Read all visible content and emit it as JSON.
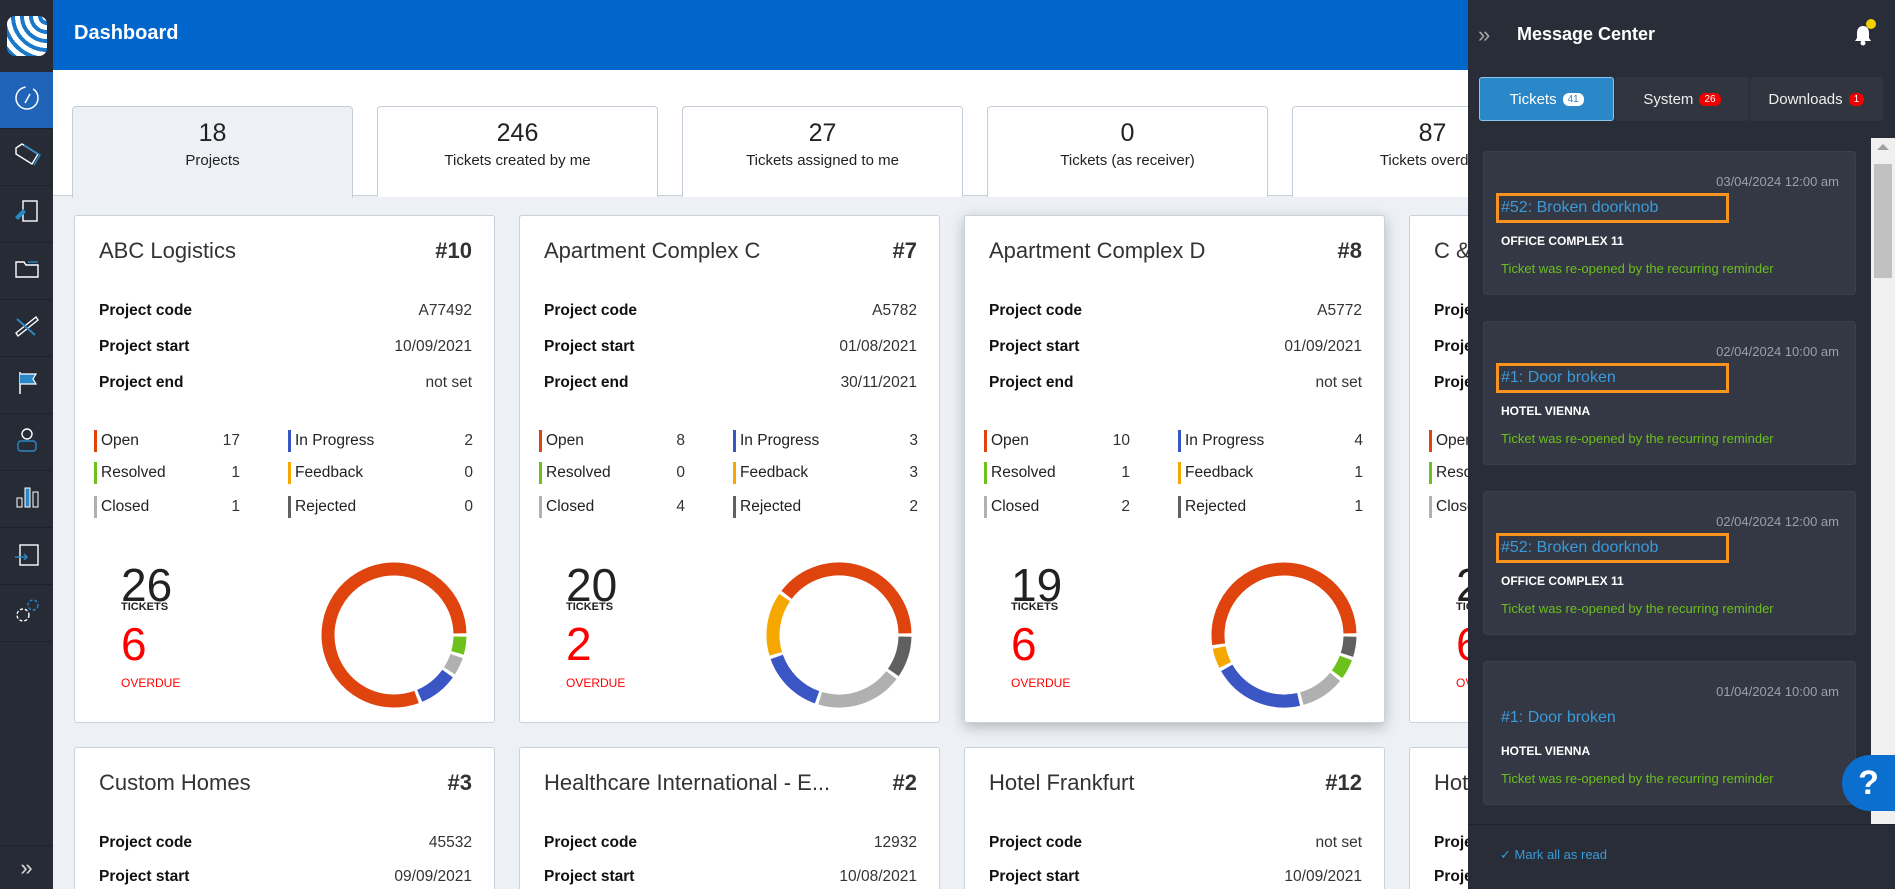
{
  "header": {
    "title": "Dashboard"
  },
  "stats": [
    {
      "value": "18",
      "label": "Projects"
    },
    {
      "value": "246",
      "label": "Tickets created by me"
    },
    {
      "value": "27",
      "label": "Tickets assigned to me"
    },
    {
      "value": "0",
      "label": "Tickets (as receiver)"
    },
    {
      "value": "87",
      "label": "Tickets overdue"
    }
  ],
  "labels": {
    "code": "Project code",
    "start": "Project start",
    "end": "Project end",
    "open": "Open",
    "in_progress": "In Progress",
    "resolved": "Resolved",
    "feedback": "Feedback",
    "closed": "Closed",
    "rejected": "Rejected",
    "tickets": "TICKETS",
    "overdue": "OVERDUE"
  },
  "colors": {
    "open": "#e0440e",
    "in_progress": "#3a55c4",
    "resolved": "#6cc21a",
    "feedback": "#f7a800",
    "closed": "#b0b0b0",
    "rejected": "#606060"
  },
  "projects": [
    {
      "name": "ABC Logistics",
      "num": "#10",
      "code": "A77492",
      "start": "10/09/2021",
      "end": "not set",
      "open": 17,
      "in_progress": 2,
      "resolved": 1,
      "feedback": 0,
      "closed": 1,
      "rejected": 0,
      "tickets": "26",
      "overdue": "6"
    },
    {
      "name": "Apartment Complex C",
      "num": "#7",
      "code": "A5782",
      "start": "01/08/2021",
      "end": "30/11/2021",
      "open": 8,
      "in_progress": 3,
      "resolved": 0,
      "feedback": 3,
      "closed": 4,
      "rejected": 2,
      "tickets": "20",
      "overdue": "2"
    },
    {
      "name": "Apartment Complex D",
      "num": "#8",
      "code": "A5772",
      "start": "01/09/2021",
      "end": "not set",
      "open": 10,
      "in_progress": 4,
      "resolved": 1,
      "feedback": 1,
      "closed": 2,
      "rejected": 1,
      "tickets": "19",
      "overdue": "6"
    },
    {
      "name": "C &",
      "num": "",
      "code": "",
      "start": "",
      "end": "",
      "tickets": "2",
      "overdue": "6"
    }
  ],
  "projects_row2": [
    {
      "name": "Custom Homes",
      "num": "#3",
      "code": "45532",
      "start": "09/09/2021"
    },
    {
      "name": "Healthcare International - E...",
      "num": "#2",
      "code": "12932",
      "start": "10/08/2021"
    },
    {
      "name": "Hotel Frankfurt",
      "num": "#12",
      "code": "not set",
      "start": "10/09/2021"
    },
    {
      "name": "Hot",
      "num": "",
      "code": "",
      "start": ""
    }
  ],
  "panel": {
    "title": "Message Center",
    "tabs": [
      {
        "label": "Tickets",
        "count": "41"
      },
      {
        "label": "System",
        "count": "26"
      },
      {
        "label": "Downloads",
        "count": "1"
      }
    ],
    "messages": [
      {
        "time": "03/04/2024 12:00 am",
        "title": "#52: Broken doorknob",
        "project": "OFFICE COMPLEX 11",
        "text": "Ticket was re-opened by the recurring reminder"
      },
      {
        "time": "02/04/2024 10:00 am",
        "title": "#1: Door broken",
        "project": "HOTEL VIENNA",
        "text": "Ticket was re-opened by the recurring reminder"
      },
      {
        "time": "02/04/2024 12:00 am",
        "title": "#52: Broken doorknob",
        "project": "OFFICE COMPLEX 11",
        "text": "Ticket was re-opened by the recurring reminder"
      },
      {
        "time": "01/04/2024 10:00 am",
        "title": "#1: Door broken",
        "project": "HOTEL VIENNA",
        "text": "Ticket was re-opened by the recurring reminder"
      }
    ],
    "mark_all": "Mark all as read"
  },
  "help": "?"
}
